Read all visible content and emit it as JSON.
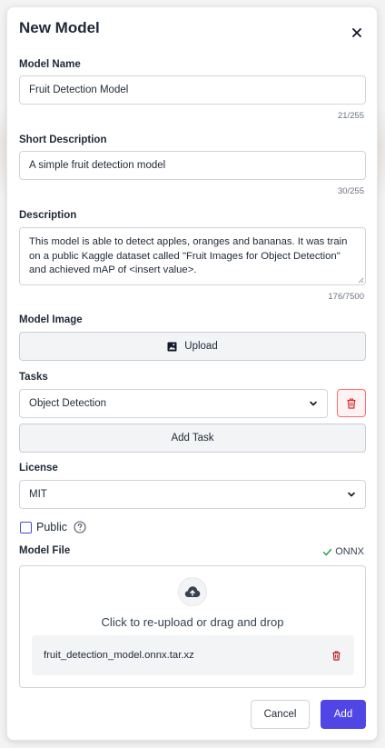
{
  "modal": {
    "title": "New Model",
    "close_icon": "close-icon"
  },
  "model_name": {
    "label": "Model Name",
    "value": "Fruit Detection Model",
    "counter": "21/255"
  },
  "short_description": {
    "label": "Short Description",
    "value": "A simple fruit detection model",
    "counter": "30/255"
  },
  "description": {
    "label": "Description",
    "value": "This model is able to detect apples, oranges and bananas. It was train on a public Kaggle dataset called \"Fruit Images for Object Detection\" and achieved mAP of <insert value>.",
    "counter": "176/7500"
  },
  "model_image": {
    "label": "Model Image",
    "upload_label": "Upload",
    "icon": "image-icon"
  },
  "tasks": {
    "label": "Tasks",
    "selected": "Object Detection",
    "delete_icon": "trash-icon",
    "add_task_label": "Add Task"
  },
  "license": {
    "label": "License",
    "selected": "MIT"
  },
  "public": {
    "label": "Public",
    "checked": false,
    "help_icon": "question-circle-icon"
  },
  "model_file": {
    "label": "Model File",
    "format_status": "ONNX",
    "status_icon": "check-icon",
    "dropzone_text": "Click to re-upload or drag and drop",
    "upload_icon": "cloud-upload-icon",
    "file_name": "fruit_detection_model.onnx.tar.xz",
    "file_delete_icon": "trash-icon"
  },
  "actions": {
    "cancel_label": "Cancel",
    "add_label": "Add"
  },
  "colors": {
    "primary": "#4f46e5",
    "danger": "#dc2626",
    "success": "#16a34a"
  }
}
